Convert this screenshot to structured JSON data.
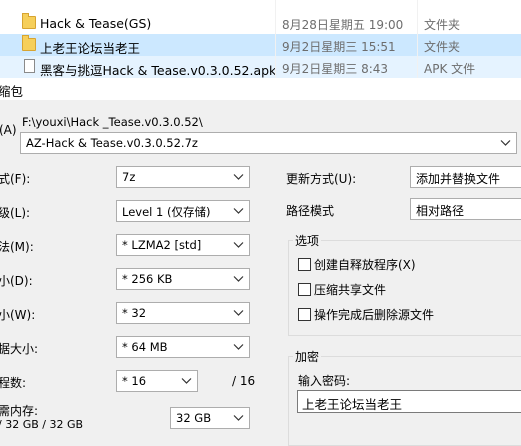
{
  "files": [
    {
      "name": "Hack & Tease(GS)",
      "date": "8月28日星期五 19:00",
      "type": "文件夹",
      "icon": "folder-icon",
      "state": "normal"
    },
    {
      "name": "上老王论坛当老王",
      "date": "9月2日星期三 15:51",
      "type": "文件夹",
      "icon": "folder-icon",
      "state": "selected"
    },
    {
      "name": "黑客与挑逗Hack & Tease.v0.3.0.52.apk",
      "date": "9月2日星期三 8:43",
      "type": "APK 文件",
      "icon": "file-icon",
      "state": "hover"
    }
  ],
  "dialog": {
    "title": "缩包",
    "archive_label": "(A)",
    "path": "F:\\youxi\\Hack _Tease.v0.3.0.52\\",
    "archive_name": "AZ-Hack & Tease.v0.3.0.52.7z",
    "format_label": "式(F):",
    "format_value": "7z",
    "level_label": "级(L):",
    "level_value": "Level 1 (仅存储)",
    "method_label": "法(M):",
    "method_value": "* LZMA2 [std]",
    "dict_label": "小(D):",
    "dict_value": "* 256 KB",
    "word_label": "小(W):",
    "word_value": "* 32",
    "block_label": "据大小:",
    "block_value": "* 64 MB",
    "threads_label": "程数:",
    "threads_value": "* 16",
    "threads_max": "/ 16",
    "memory_label": "需内存:",
    "memory_usage": "/ 32 GB / 32 GB",
    "memory_value": "32 GB",
    "update_label": "更新方式(U):",
    "update_value": "添加并替换文件",
    "pathmode_label": "路径模式",
    "pathmode_value": "相对路径",
    "options_title": "选项",
    "opt_sfx": "创建自释放程序(X)",
    "opt_shared": "压缩共享文件",
    "opt_delete": "操作完成后删除源文件",
    "encrypt_title": "加密",
    "password_label": "输入密码:",
    "password_value": "上老王论坛当老王"
  }
}
